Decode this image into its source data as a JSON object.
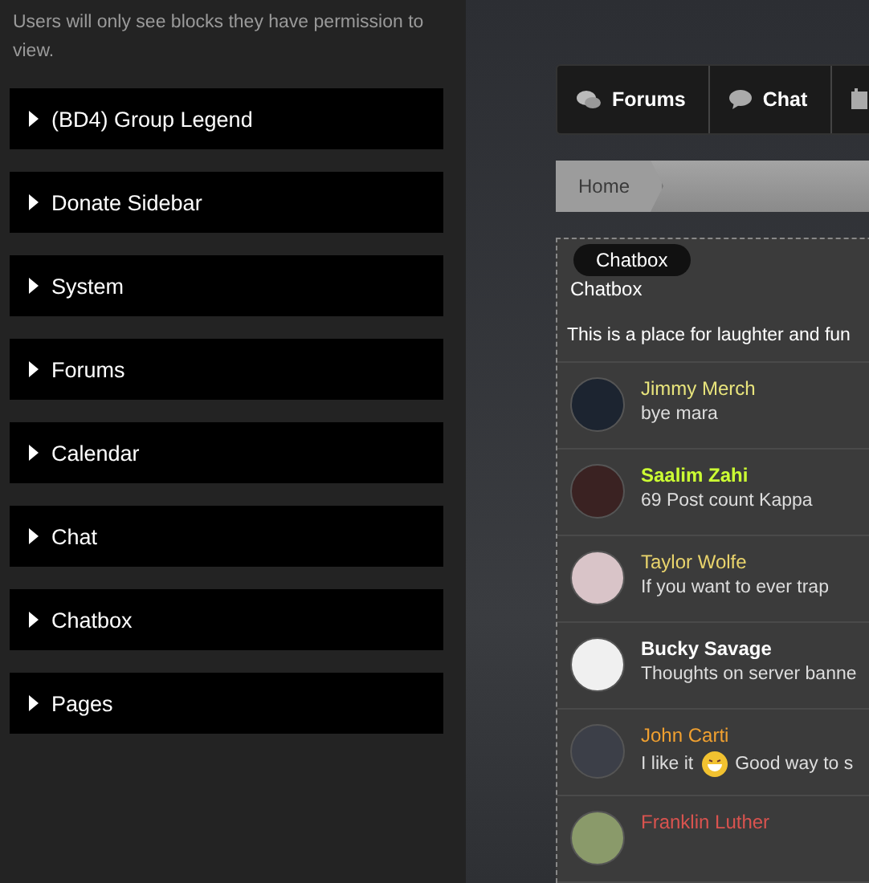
{
  "sidebar": {
    "note": "Users will only see blocks they have permission to view.",
    "blocks": [
      {
        "label": "(BD4) Group Legend",
        "expanded": false
      },
      {
        "label": "Donate Sidebar",
        "expanded": false
      },
      {
        "label": "System",
        "expanded": false
      },
      {
        "label": "Forums",
        "expanded": false
      },
      {
        "label": "Calendar",
        "expanded": false
      },
      {
        "label": "Chat",
        "expanded": false
      },
      {
        "label": "Chatbox",
        "expanded": false
      },
      {
        "label": "Pages",
        "expanded": false
      }
    ]
  },
  "nav": {
    "tabs": [
      {
        "label": "Forums",
        "kind": "forums"
      },
      {
        "label": "Chat",
        "kind": "chat"
      },
      {
        "kind": "calendar"
      }
    ]
  },
  "breadcrumb": [
    "Home"
  ],
  "chatbox": {
    "tooltip": "Chatbox",
    "title": "Chatbox",
    "description": "This is a place for laughter and fun",
    "messages": [
      {
        "author": "Jimmy Merch",
        "color": "#e8e47c",
        "bold": false,
        "text": "bye mara"
      },
      {
        "author": "Saalim Zahi",
        "color": "#ccff33",
        "bold": true,
        "text": "69 Post count Kappa"
      },
      {
        "author": "Taylor Wolfe",
        "color": "#e9d46c",
        "bold": false,
        "text": "If you want to ever trap"
      },
      {
        "author": "Bucky Savage",
        "color": "#ffffff",
        "bold": true,
        "text": "Thoughts on server banne"
      },
      {
        "author": "John Carti",
        "color": "#f0a030",
        "bold": false,
        "text": "I like it",
        "emoji": true,
        "text_after": "Good way to s"
      },
      {
        "author": "Franklin Luther",
        "color": "#d9534f",
        "bold": false
      }
    ]
  }
}
